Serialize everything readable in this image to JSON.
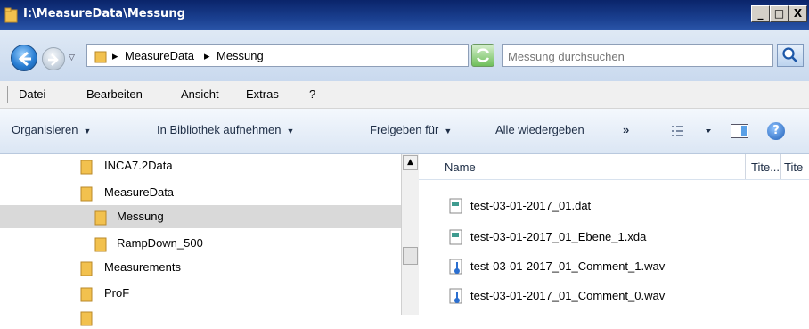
{
  "window": {
    "title": "I:\\MeasureData\\Messung",
    "minimize_label": "_",
    "maximize_label": "□",
    "close_label": "X"
  },
  "address": {
    "crumbs": [
      "MeasureData",
      "Messung"
    ],
    "crumb_separator": "▸",
    "search_placeholder": "Messung durchsuchen"
  },
  "menu": {
    "items": [
      "Datei",
      "Bearbeiten",
      "Ansicht",
      "Extras",
      "?"
    ]
  },
  "commands": {
    "organize": "Organisieren",
    "library": "In Bibliothek aufnehmen",
    "share": "Freigeben für",
    "play_all": "Alle wiedergeben",
    "more": "»",
    "help": "?"
  },
  "tree": {
    "items": [
      {
        "label": "INCA7.2Data",
        "level": 0,
        "selected": false
      },
      {
        "label": "MeasureData",
        "level": 0,
        "selected": false
      },
      {
        "label": "Messung",
        "level": 1,
        "selected": true
      },
      {
        "label": "RampDown_500",
        "level": 1,
        "selected": false
      },
      {
        "label": "Measurements",
        "level": 0,
        "selected": false
      },
      {
        "label": "ProF",
        "level": 0,
        "selected": false
      }
    ]
  },
  "files": {
    "columns": [
      "Name",
      "Tite...",
      "Tite"
    ],
    "rows": [
      {
        "name": "test-03-01-2017_01.dat",
        "icon": "data-file-icon"
      },
      {
        "name": "test-03-01-2017_01_Ebene_1.xda",
        "icon": "data-file-icon"
      },
      {
        "name": "test-03-01-2017_01_Comment_1.wav",
        "icon": "audio-file-icon"
      },
      {
        "name": "test-03-01-2017_01_Comment_0.wav",
        "icon": "audio-file-icon"
      }
    ]
  },
  "colors": {
    "titlebar": "#0a246a",
    "folder": "#f2c14e",
    "selection": "#d9d9d9",
    "audio_icon": "#2b6fd0"
  }
}
